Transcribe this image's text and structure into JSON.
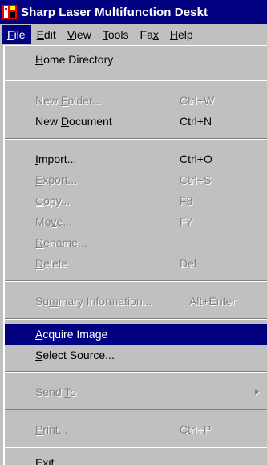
{
  "window": {
    "title": "Sharp Laser Multifunction Deskt",
    "icon": "app-icon"
  },
  "menubar": {
    "items": [
      {
        "label": "File",
        "mnemonic": "F",
        "active": true
      },
      {
        "label": "Edit",
        "mnemonic": "E",
        "active": false
      },
      {
        "label": "View",
        "mnemonic": "V",
        "active": false
      },
      {
        "label": "Tools",
        "mnemonic": "T",
        "active": false
      },
      {
        "label": "Fax",
        "mnemonic": "x",
        "active": false
      },
      {
        "label": "Help",
        "mnemonic": "H",
        "active": false
      }
    ]
  },
  "file_menu": {
    "items": [
      {
        "label": "Home Directory",
        "shortcut": "",
        "enabled": true
      },
      {
        "label": "New Folder...",
        "shortcut": "Ctrl+W",
        "enabled": false
      },
      {
        "label": "New Document",
        "shortcut": "Ctrl+N",
        "enabled": true
      },
      {
        "label": "Import...",
        "shortcut": "Ctrl+O",
        "enabled": true
      },
      {
        "label": "Export...",
        "shortcut": "Ctrl+S",
        "enabled": false
      },
      {
        "label": "Copy...",
        "shortcut": "F8",
        "enabled": false
      },
      {
        "label": "Move...",
        "shortcut": "F7",
        "enabled": false
      },
      {
        "label": "Rename...",
        "shortcut": "",
        "enabled": false
      },
      {
        "label": "Delete",
        "shortcut": "Del",
        "enabled": false
      },
      {
        "label": "Summary Information...",
        "shortcut": "Alt+Enter",
        "enabled": false
      },
      {
        "label": "Acquire Image",
        "shortcut": "",
        "enabled": true,
        "highlighted": true
      },
      {
        "label": "Select Source...",
        "shortcut": "",
        "enabled": true
      },
      {
        "label": "Send To",
        "shortcut": "",
        "enabled": false,
        "submenu": true
      },
      {
        "label": "Print...",
        "shortcut": "Ctrl+P",
        "enabled": false
      },
      {
        "label": "Exit",
        "shortcut": "",
        "enabled": true
      }
    ]
  },
  "colors": {
    "title_bar": "#000080",
    "menu_face": "#c0c0c0",
    "highlight": "#000080",
    "disabled_text": "#808080"
  }
}
